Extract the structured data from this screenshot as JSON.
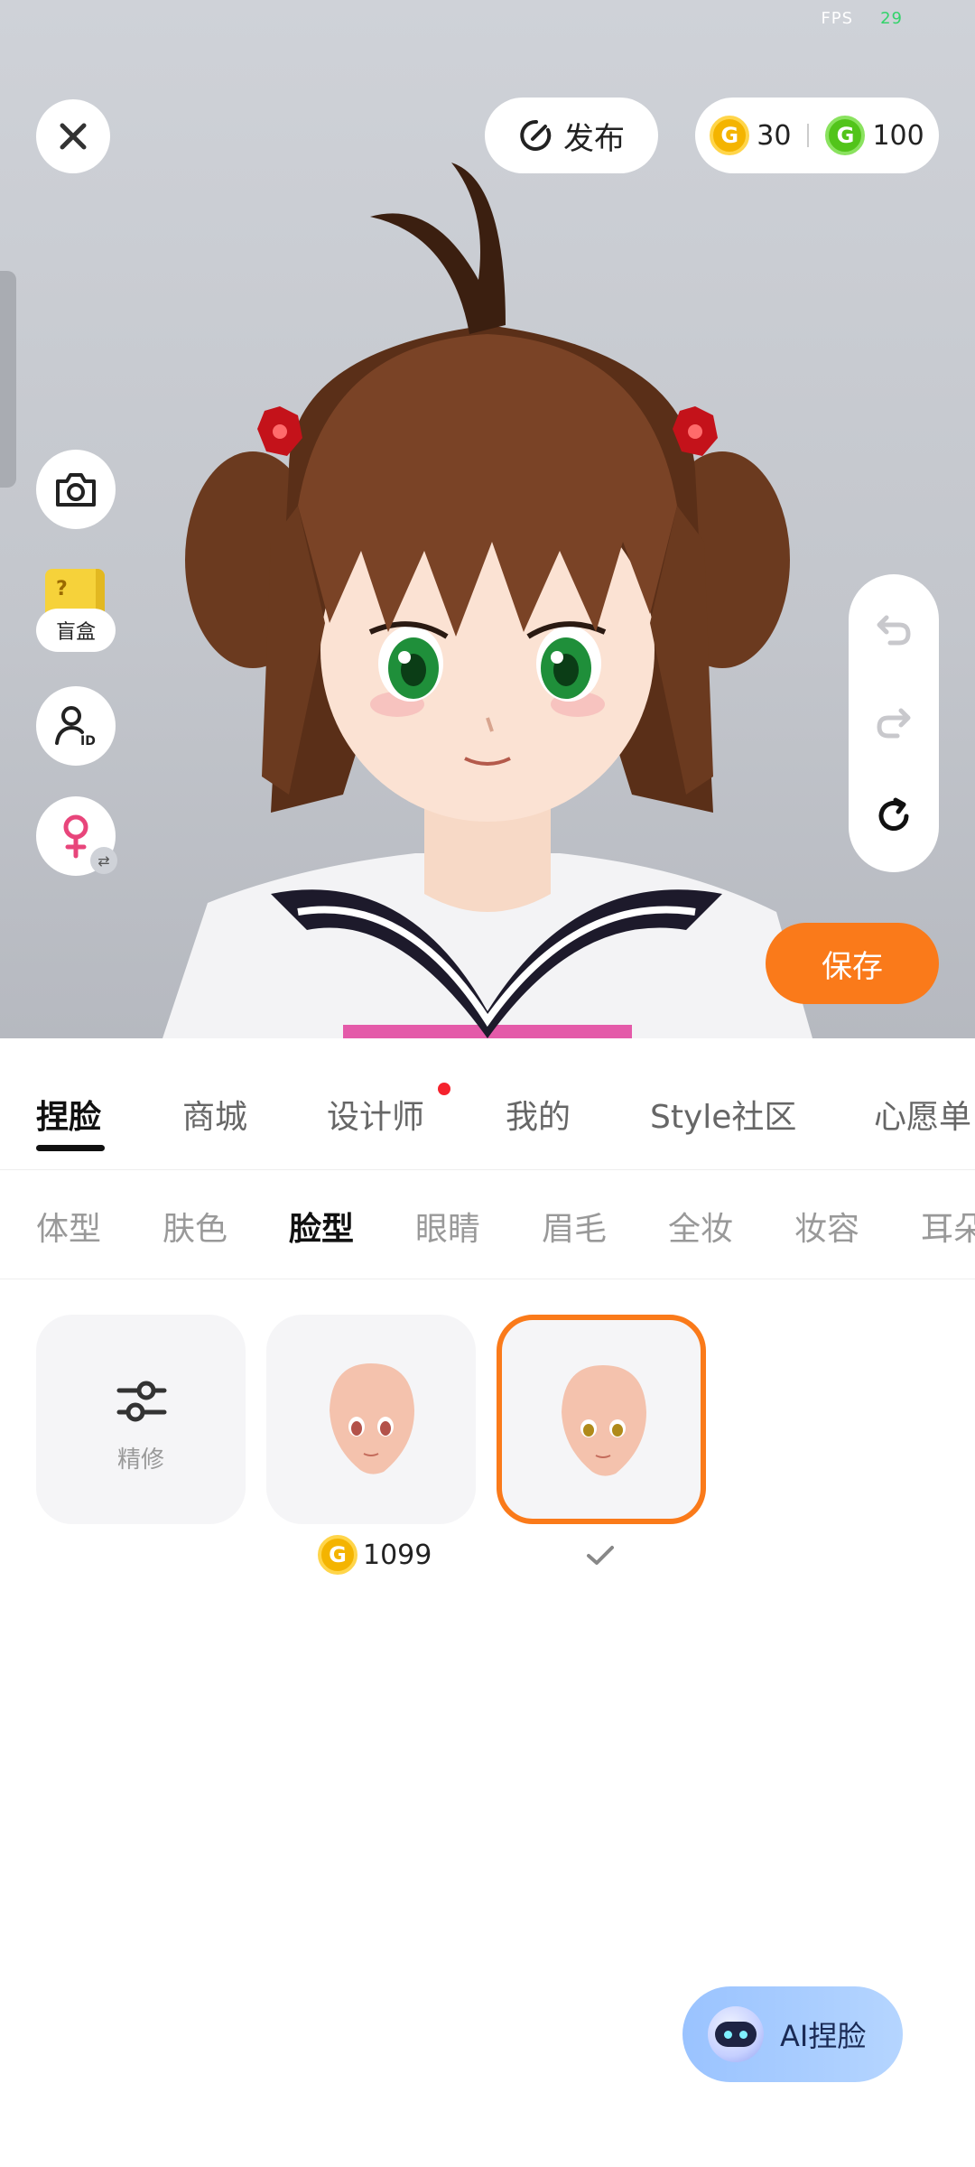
{
  "status": {
    "fps_label": "FPS",
    "fps_value": "29"
  },
  "top_bar": {
    "publish_label": "发布",
    "gold_coins": "30",
    "green_coins": "100"
  },
  "left_tools": {
    "blind_box_label": "盲盒"
  },
  "save_label": "保存",
  "main_tabs": [
    {
      "label": "捏脸"
    },
    {
      "label": "商城"
    },
    {
      "label": "设计师"
    },
    {
      "label": "我的"
    },
    {
      "label": "Style社区"
    },
    {
      "label": "心愿单"
    }
  ],
  "sub_tabs": [
    {
      "label": "体型"
    },
    {
      "label": "肤色"
    },
    {
      "label": "脸型"
    },
    {
      "label": "眼睛"
    },
    {
      "label": "眉毛"
    },
    {
      "label": "全妆"
    },
    {
      "label": "妆容"
    },
    {
      "label": "耳朵"
    }
  ],
  "options": {
    "refine_label": "精修",
    "item1_price": "1099"
  },
  "ai_button_label": "AI捏脸",
  "colors": {
    "accent": "#fa7a1a",
    "gold": "#f4b400",
    "green": "#52c41a",
    "notify": "#f5222d"
  },
  "icons": [
    "close-icon",
    "publish-icon",
    "gold-coin-icon",
    "green-coin-icon",
    "camera-icon",
    "blind-box-icon",
    "user-id-icon",
    "female-icon",
    "swap-icon",
    "undo-icon",
    "redo-icon",
    "reset-icon",
    "sliders-icon",
    "check-icon",
    "robot-icon"
  ]
}
